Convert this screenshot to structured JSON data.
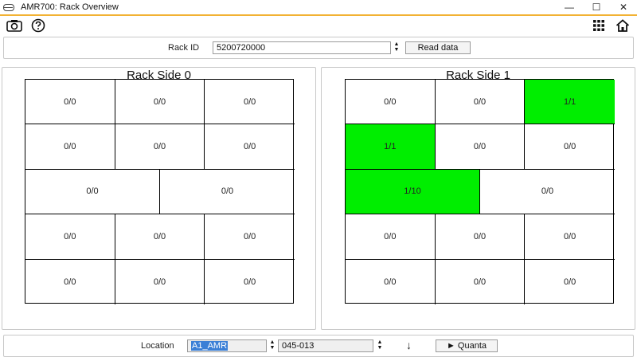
{
  "window": {
    "title": "AMR700: Rack Overview",
    "controls": [
      "—",
      "☐",
      "✕"
    ]
  },
  "toolbar": {
    "left_icons": [
      "camera-icon",
      "help-icon"
    ],
    "right_icons": [
      "grid-menu-icon",
      "home-icon"
    ]
  },
  "rack": {
    "label": "Rack ID",
    "value": "5200720000",
    "read_button": "Read data"
  },
  "sides": [
    {
      "title": "Rack Side 0",
      "rows": [
        [
          {
            "text": "0/0",
            "status": "empty"
          },
          {
            "text": "0/0",
            "status": "empty"
          },
          {
            "text": "0/0",
            "status": "empty"
          }
        ],
        [
          {
            "text": "0/0",
            "status": "empty"
          },
          {
            "text": "0/0",
            "status": "empty"
          },
          {
            "text": "0/0",
            "status": "empty"
          }
        ],
        [
          {
            "text": "0/0",
            "status": "empty"
          },
          {
            "text": "0/0",
            "status": "empty"
          }
        ],
        [
          {
            "text": "0/0",
            "status": "empty"
          },
          {
            "text": "0/0",
            "status": "empty"
          },
          {
            "text": "0/0",
            "status": "empty"
          }
        ],
        [
          {
            "text": "0/0",
            "status": "empty"
          },
          {
            "text": "0/0",
            "status": "empty"
          },
          {
            "text": "0/0",
            "status": "empty"
          }
        ]
      ]
    },
    {
      "title": "Rack Side 1",
      "rows": [
        [
          {
            "text": "0/0",
            "status": "empty"
          },
          {
            "text": "0/0",
            "status": "empty"
          },
          {
            "text": "1/1",
            "status": "filled"
          }
        ],
        [
          {
            "text": "1/1",
            "status": "filled"
          },
          {
            "text": "0/0",
            "status": "empty"
          },
          {
            "text": "0/0",
            "status": "empty"
          }
        ],
        [
          {
            "text": "1/10",
            "status": "filled"
          },
          {
            "text": "0/0",
            "status": "empty"
          }
        ],
        [
          {
            "text": "0/0",
            "status": "empty"
          },
          {
            "text": "0/0",
            "status": "empty"
          },
          {
            "text": "0/0",
            "status": "empty"
          }
        ],
        [
          {
            "text": "0/0",
            "status": "empty"
          },
          {
            "text": "0/0",
            "status": "empty"
          },
          {
            "text": "0/0",
            "status": "empty"
          }
        ]
      ]
    }
  ],
  "location": {
    "label": "Location",
    "value": "A1_AMR",
    "code": "045-013",
    "download_icon": "↓",
    "quanta_button": "► Quanta"
  },
  "colors": {
    "accent": "#f2b233",
    "filled": "#00ee00",
    "selection": "#3b7fd6"
  }
}
